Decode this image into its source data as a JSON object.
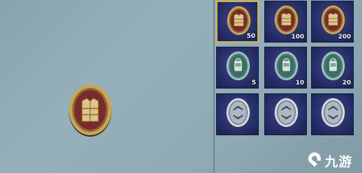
{
  "preview": {
    "icon": "armor-vest-medal-icon"
  },
  "inventory": {
    "selected_index": 0,
    "slots": [
      {
        "icon": "armor-vest-medal-icon",
        "tier": "red",
        "count": "50"
      },
      {
        "icon": "armor-vest-medal-icon",
        "tier": "red",
        "count": "100"
      },
      {
        "icon": "armor-vest-medal-icon",
        "tier": "red",
        "count": "200"
      },
      {
        "icon": "backpack-medal-icon",
        "tier": "teal",
        "count": "5"
      },
      {
        "icon": "backpack-medal-icon",
        "tier": "teal",
        "count": "10"
      },
      {
        "icon": "backpack-medal-icon",
        "tier": "teal",
        "count": "20"
      },
      {
        "icon": "circular-token-icon",
        "tier": "silver",
        "count": ""
      },
      {
        "icon": "circular-token-icon",
        "tier": "silver",
        "count": ""
      },
      {
        "icon": "circular-token-icon",
        "tier": "silver",
        "count": ""
      }
    ]
  },
  "watermark": {
    "text": "九游",
    "icon": "jiuyou-logo-icon"
  },
  "colors": {
    "slot_bg": "#242b63",
    "selected_border": "#d9b24a",
    "medal_gold": "#c9a55a",
    "medal_red": "#7a2a2a",
    "medal_teal": "#3e6d66"
  }
}
